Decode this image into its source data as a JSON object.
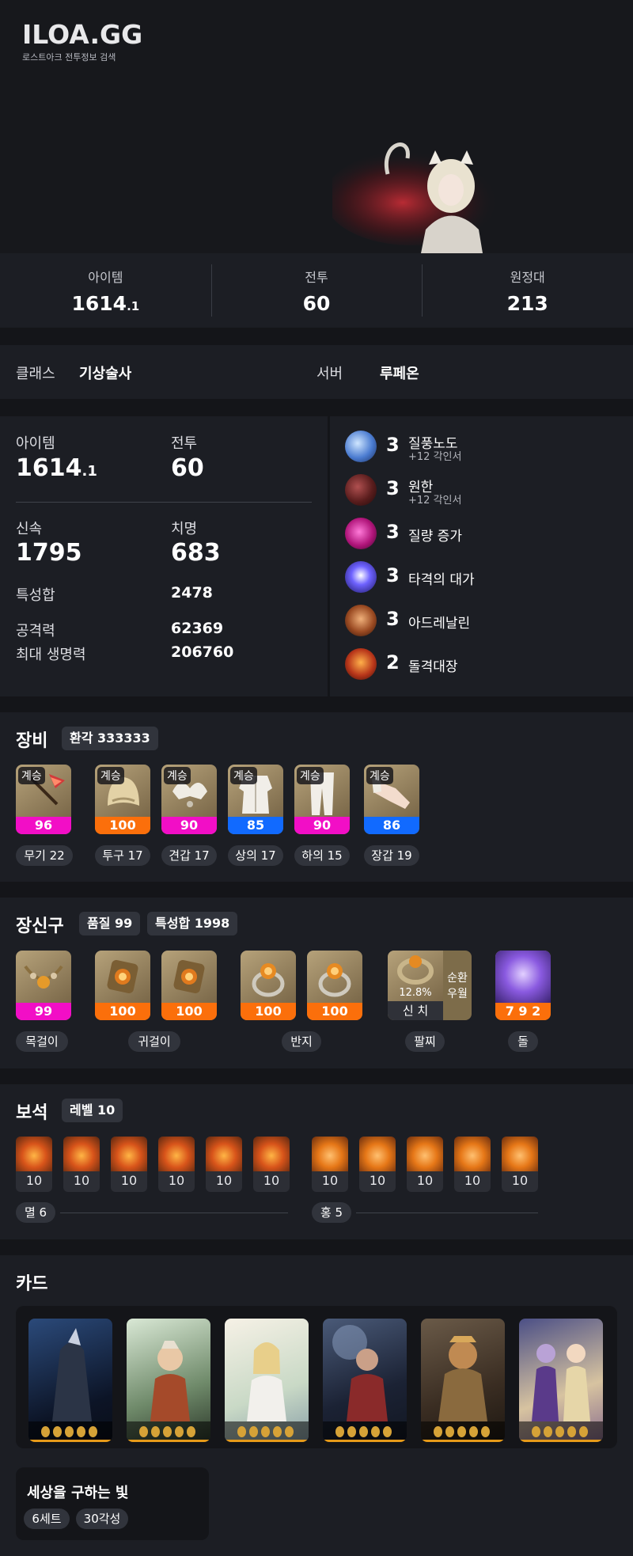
{
  "header": {
    "logo": "ILOA.GG",
    "subtitle": "로스트아크 전투정보 검색"
  },
  "top_stats": [
    {
      "label": "아이템",
      "value": "1614",
      "decimal": ".1"
    },
    {
      "label": "전투",
      "value": "60"
    },
    {
      "label": "원정대",
      "value": "213"
    }
  ],
  "class_row": {
    "class_label": "클래스",
    "class_value": "기상술사",
    "server_label": "서버",
    "server_value": "루페온"
  },
  "stats": {
    "item_label": "아이템",
    "item_value": "1614",
    "item_decimal": ".1",
    "battle_label": "전투",
    "battle_value": "60",
    "swift_label": "신속",
    "swift_value": "1795",
    "crit_label": "치명",
    "crit_value": "683",
    "trait_label": "특성합",
    "trait_value": "2478",
    "atk_label": "공격력",
    "atk_value": "62369",
    "hp_label": "최대 생명력",
    "hp_value": "206760"
  },
  "engravings": [
    {
      "level": "3",
      "name": "질풍노도",
      "sub": "+12 각인서",
      "color": "#4a7bd0"
    },
    {
      "level": "3",
      "name": "원한",
      "sub": "+12 각인서",
      "color": "#5a1d1d"
    },
    {
      "level": "3",
      "name": "질량 증가",
      "sub": "",
      "color": "#b0157a"
    },
    {
      "level": "3",
      "name": "타격의 대가",
      "sub": "",
      "color": "#3a2fb8"
    },
    {
      "level": "3",
      "name": "아드레날린",
      "sub": "",
      "color": "#9a4a22"
    },
    {
      "level": "2",
      "name": "돌격대장",
      "sub": "",
      "color": "#b8361a"
    }
  ],
  "equipment": {
    "title": "장비",
    "badge": "환각 333333",
    "items": [
      {
        "tag": "계승",
        "quality": "96",
        "label": "무기 22",
        "qcolor": "pink"
      },
      {
        "tag": "계승",
        "quality": "100",
        "label": "투구 17",
        "qcolor": "orange"
      },
      {
        "tag": "계승",
        "quality": "90",
        "label": "견갑 17",
        "qcolor": "pink"
      },
      {
        "tag": "계승",
        "quality": "85",
        "label": "상의 17",
        "qcolor": "blue"
      },
      {
        "tag": "계승",
        "quality": "90",
        "label": "하의 15",
        "qcolor": "pink"
      },
      {
        "tag": "계승",
        "quality": "86",
        "label": "장갑 19",
        "qcolor": "blue"
      }
    ]
  },
  "accessories": {
    "title": "장신구",
    "badge_quality": "품질 99",
    "badge_trait": "특성합 1998",
    "items": [
      {
        "quality": "99",
        "qcolor": "pink"
      },
      {
        "quality": "100",
        "qcolor": "orange"
      },
      {
        "quality": "100",
        "qcolor": "orange"
      },
      {
        "quality": "100",
        "qcolor": "orange"
      },
      {
        "quality": "100",
        "qcolor": "orange"
      }
    ],
    "bracelet": {
      "percent": "12.8%",
      "label": "신 치",
      "side1": "순환",
      "side2": "우월"
    },
    "stone": {
      "value": "7 9 2"
    },
    "labels": {
      "necklace": "목걸이",
      "earring": "귀걸이",
      "ring": "반지",
      "bracelet": "팔찌",
      "stone": "돌"
    }
  },
  "gems": {
    "title": "보석",
    "badge": "레벨 10",
    "left": [
      "10",
      "10",
      "10",
      "10",
      "10",
      "10"
    ],
    "right": [
      "10",
      "10",
      "10",
      "10",
      "10"
    ],
    "left_label": "멸 6",
    "right_label": "홍 5"
  },
  "cards": {
    "title": "카드",
    "set_name": "세상을 구하는 빛",
    "set_count": "6세트",
    "awaken": "30각성"
  }
}
